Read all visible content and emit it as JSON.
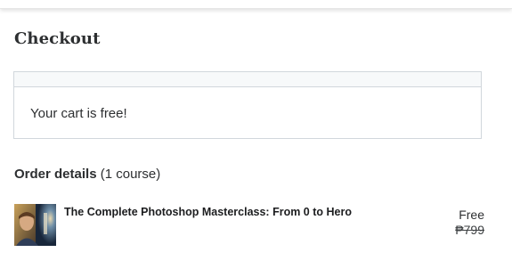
{
  "header": {
    "page_title": "Checkout"
  },
  "cart": {
    "message": "Your cart is free!"
  },
  "order_details": {
    "heading": "Order details",
    "count_text": "(1 course)",
    "items": [
      {
        "title": "The Complete Photoshop Masterclass: From 0 to Hero",
        "price": "Free",
        "original_price": "₱799",
        "thumbnail": "course-thumbnail-image"
      }
    ]
  },
  "colors": {
    "text": "#2d2f31",
    "border": "#d1d7dc",
    "box_header": "#f7f9fa"
  }
}
